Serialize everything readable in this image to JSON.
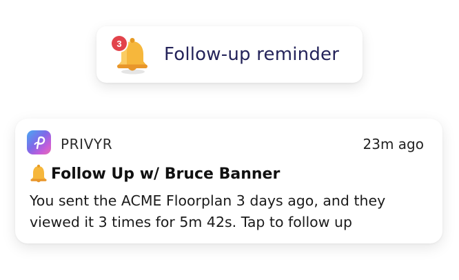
{
  "reminder": {
    "badge_count": "3",
    "label": "Follow-up reminder",
    "icon": "bell-icon"
  },
  "notification": {
    "app_name": "PRIVYR",
    "app_icon": "privyr-logo-icon",
    "timestamp": "23m ago",
    "title": "Follow Up w/ Bruce Banner",
    "title_icon": "bell-icon",
    "body": "You sent the ACME Floorplan 3 days ago, and they viewed it 3 times for 5m 42s. Tap to follow up"
  },
  "colors": {
    "badge": "#e2434b",
    "bell": "#f6b73c",
    "reminder_text": "#24235a"
  }
}
